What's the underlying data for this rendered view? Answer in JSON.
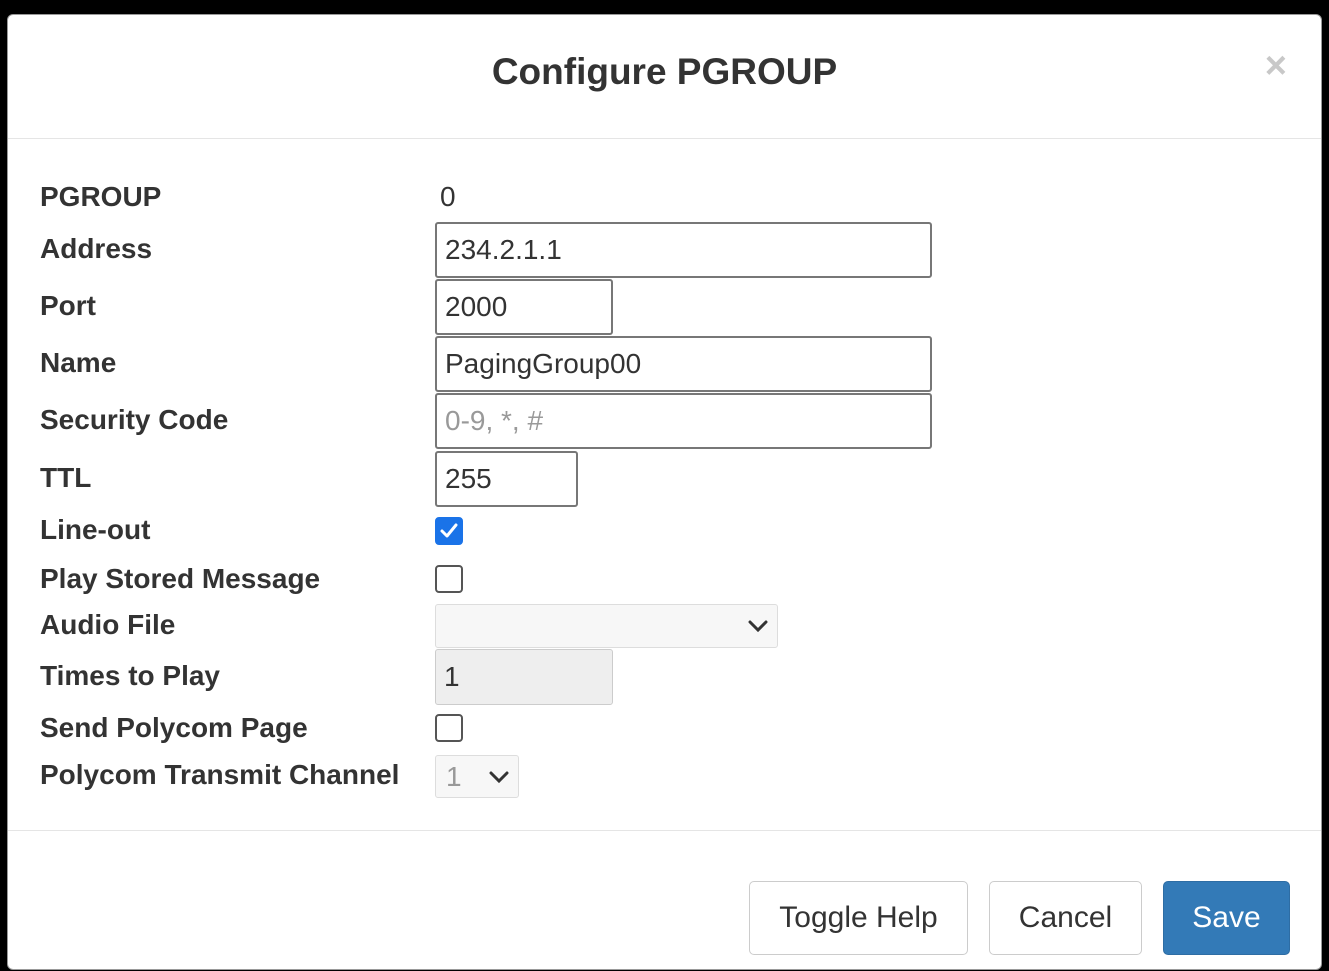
{
  "dialog": {
    "title": "Configure PGROUP",
    "close_symbol": "×"
  },
  "form": {
    "pgroup": {
      "label": "PGROUP",
      "value": "0"
    },
    "address": {
      "label": "Address",
      "value": "234.2.1.1"
    },
    "port": {
      "label": "Port",
      "value": "2000"
    },
    "name": {
      "label": "Name",
      "value": "PagingGroup00"
    },
    "security_code": {
      "label": "Security Code",
      "value": "",
      "placeholder": "0-9, *, #"
    },
    "ttl": {
      "label": "TTL",
      "value": "255"
    },
    "line_out": {
      "label": "Line-out",
      "checked": true
    },
    "play_stored_message": {
      "label": "Play Stored Message",
      "checked": false
    },
    "audio_file": {
      "label": "Audio File",
      "value": ""
    },
    "times_to_play": {
      "label": "Times to Play",
      "value": "1"
    },
    "send_polycom_page": {
      "label": "Send Polycom Page",
      "checked": false
    },
    "polycom_transmit_channel": {
      "label": "Polycom Transmit Channel",
      "value": "1"
    }
  },
  "footer": {
    "toggle_help_label": "Toggle Help",
    "cancel_label": "Cancel",
    "save_label": "Save"
  },
  "colors": {
    "primary": "#337ab7",
    "checkbox_checked": "#1a73e8"
  },
  "icons": {
    "close": "close-icon",
    "checkmark": "checkmark-icon",
    "dropdown": "chevron-down-icon"
  }
}
